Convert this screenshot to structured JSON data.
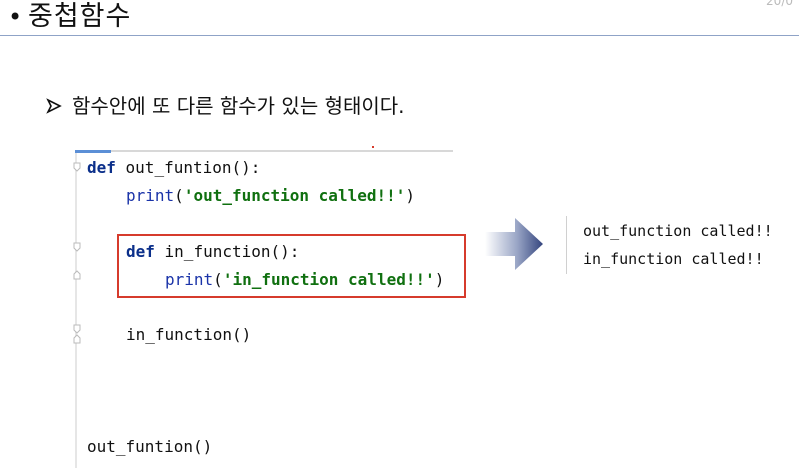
{
  "title": {
    "bullet": "•",
    "text": "중첩함수"
  },
  "page_number": "20/0",
  "sub_bullet": {
    "text": "함수안에 또 다른 함수가 있는 형태이다."
  },
  "code": {
    "line1": {
      "kw": "def",
      "rest": " out_funtion():"
    },
    "line2": {
      "fn": "print",
      "open": "(",
      "str": "'out_function called!!'",
      "close": ")"
    },
    "line3": {
      "kw": "def",
      "rest": " in_function():"
    },
    "line4": {
      "fn": "print",
      "open": "(",
      "str": "'in_function called!!'",
      "close": ")"
    },
    "line5": {
      "text": "in_function()"
    },
    "line6": {
      "text": "out_funtion()"
    }
  },
  "output": {
    "line1": "out_function called!!",
    "line2": "in_function called!!"
  },
  "colors": {
    "red_box": "#d63b2c",
    "arrow": "#3b4f8c",
    "title_rule": "#8fa3c7"
  }
}
